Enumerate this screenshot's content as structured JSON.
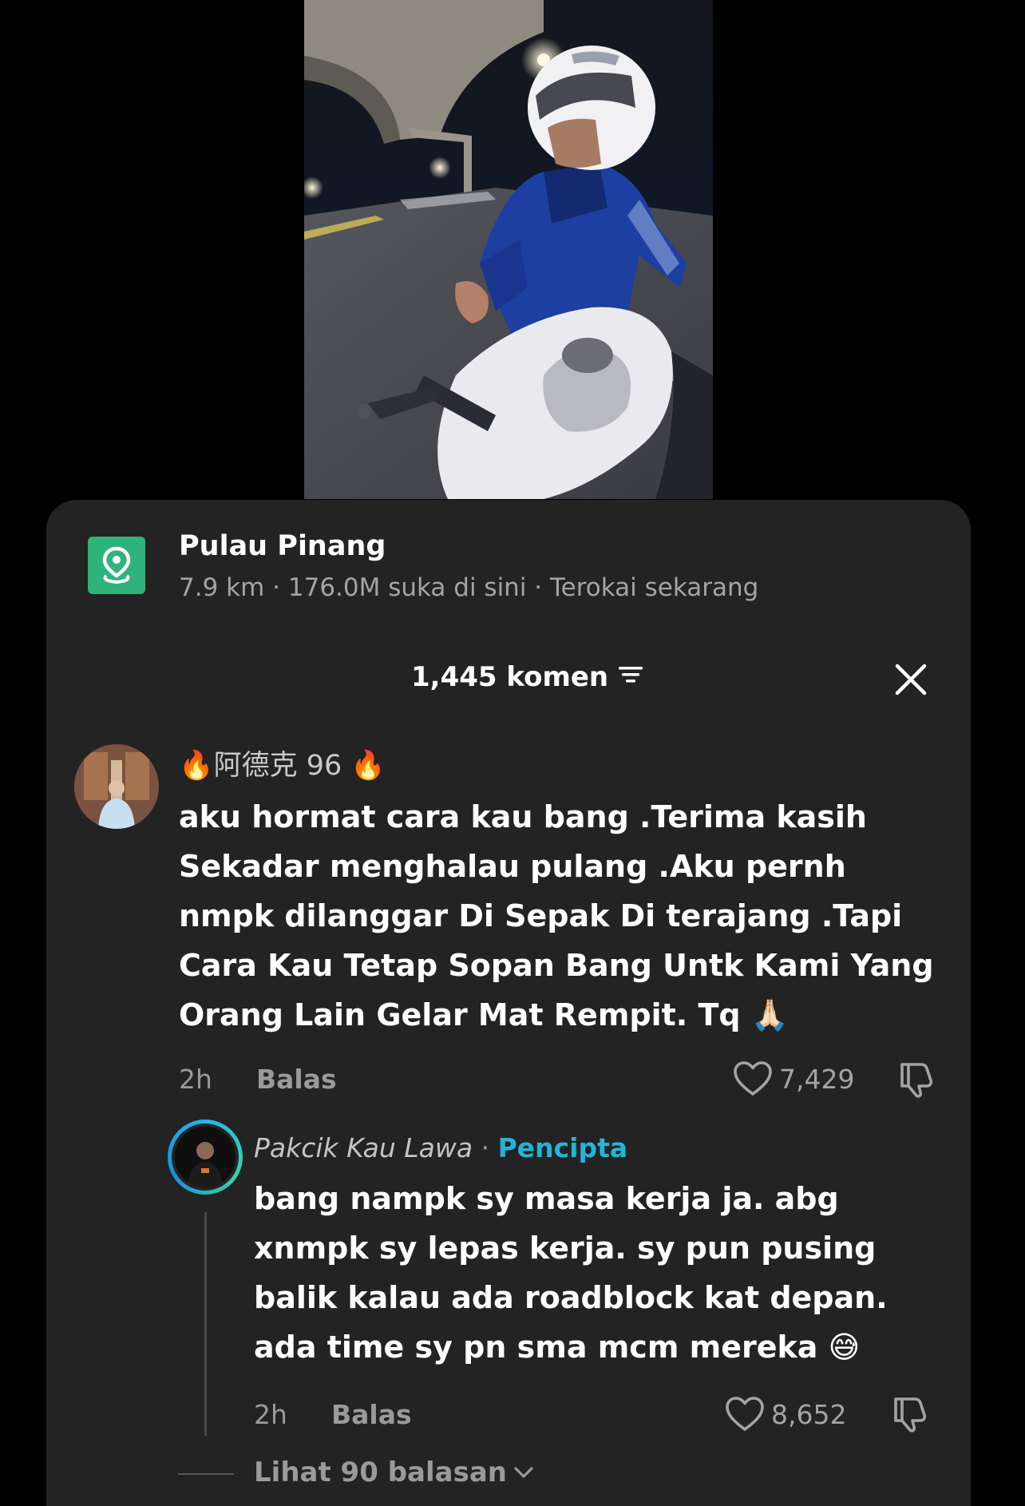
{
  "location": {
    "title": "Pulau Pinang",
    "subtitle": "7.9 km · 176.0M suka di sini · Terokai sekarang",
    "icon": "location-pin-icon",
    "accent": "#2fb37b"
  },
  "comments_header": {
    "count_label": "1,445 komen",
    "filter_icon": "filter-icon",
    "close_icon": "close-icon"
  },
  "comment": {
    "username": "🔥阿德克 96 🔥",
    "text_lines": [
      "aku hormat cara kau bang .Terima kasih",
      "Sekadar menghalau pulang .Aku pernh",
      "nmpk dilanggar Di Sepak Di terajang .Tapi",
      "Cara Kau Tetap Sopan Bang Untk Kami Yang",
      "Orang Lain Gelar Mat Rempit. Tq 🙏🏻"
    ],
    "time": "2h",
    "reply_label": "Balas",
    "likes": "7,429"
  },
  "reply": {
    "username": "Pakcik Kau Lawa",
    "separator": "·",
    "badge": "Pencipta",
    "badge_color": "#27b2d8",
    "text_lines": [
      "bang nampk sy masa kerja ja. abg",
      "xnmpk sy lepas kerja. sy pun pusing",
      "balik kalau ada roadblock kat depan.",
      "ada time sy pn sma mcm mereka 😅"
    ],
    "time": "2h",
    "reply_label": "Balas",
    "likes": "8,652"
  },
  "view_replies": {
    "label": "Lihat 90 balasan"
  }
}
